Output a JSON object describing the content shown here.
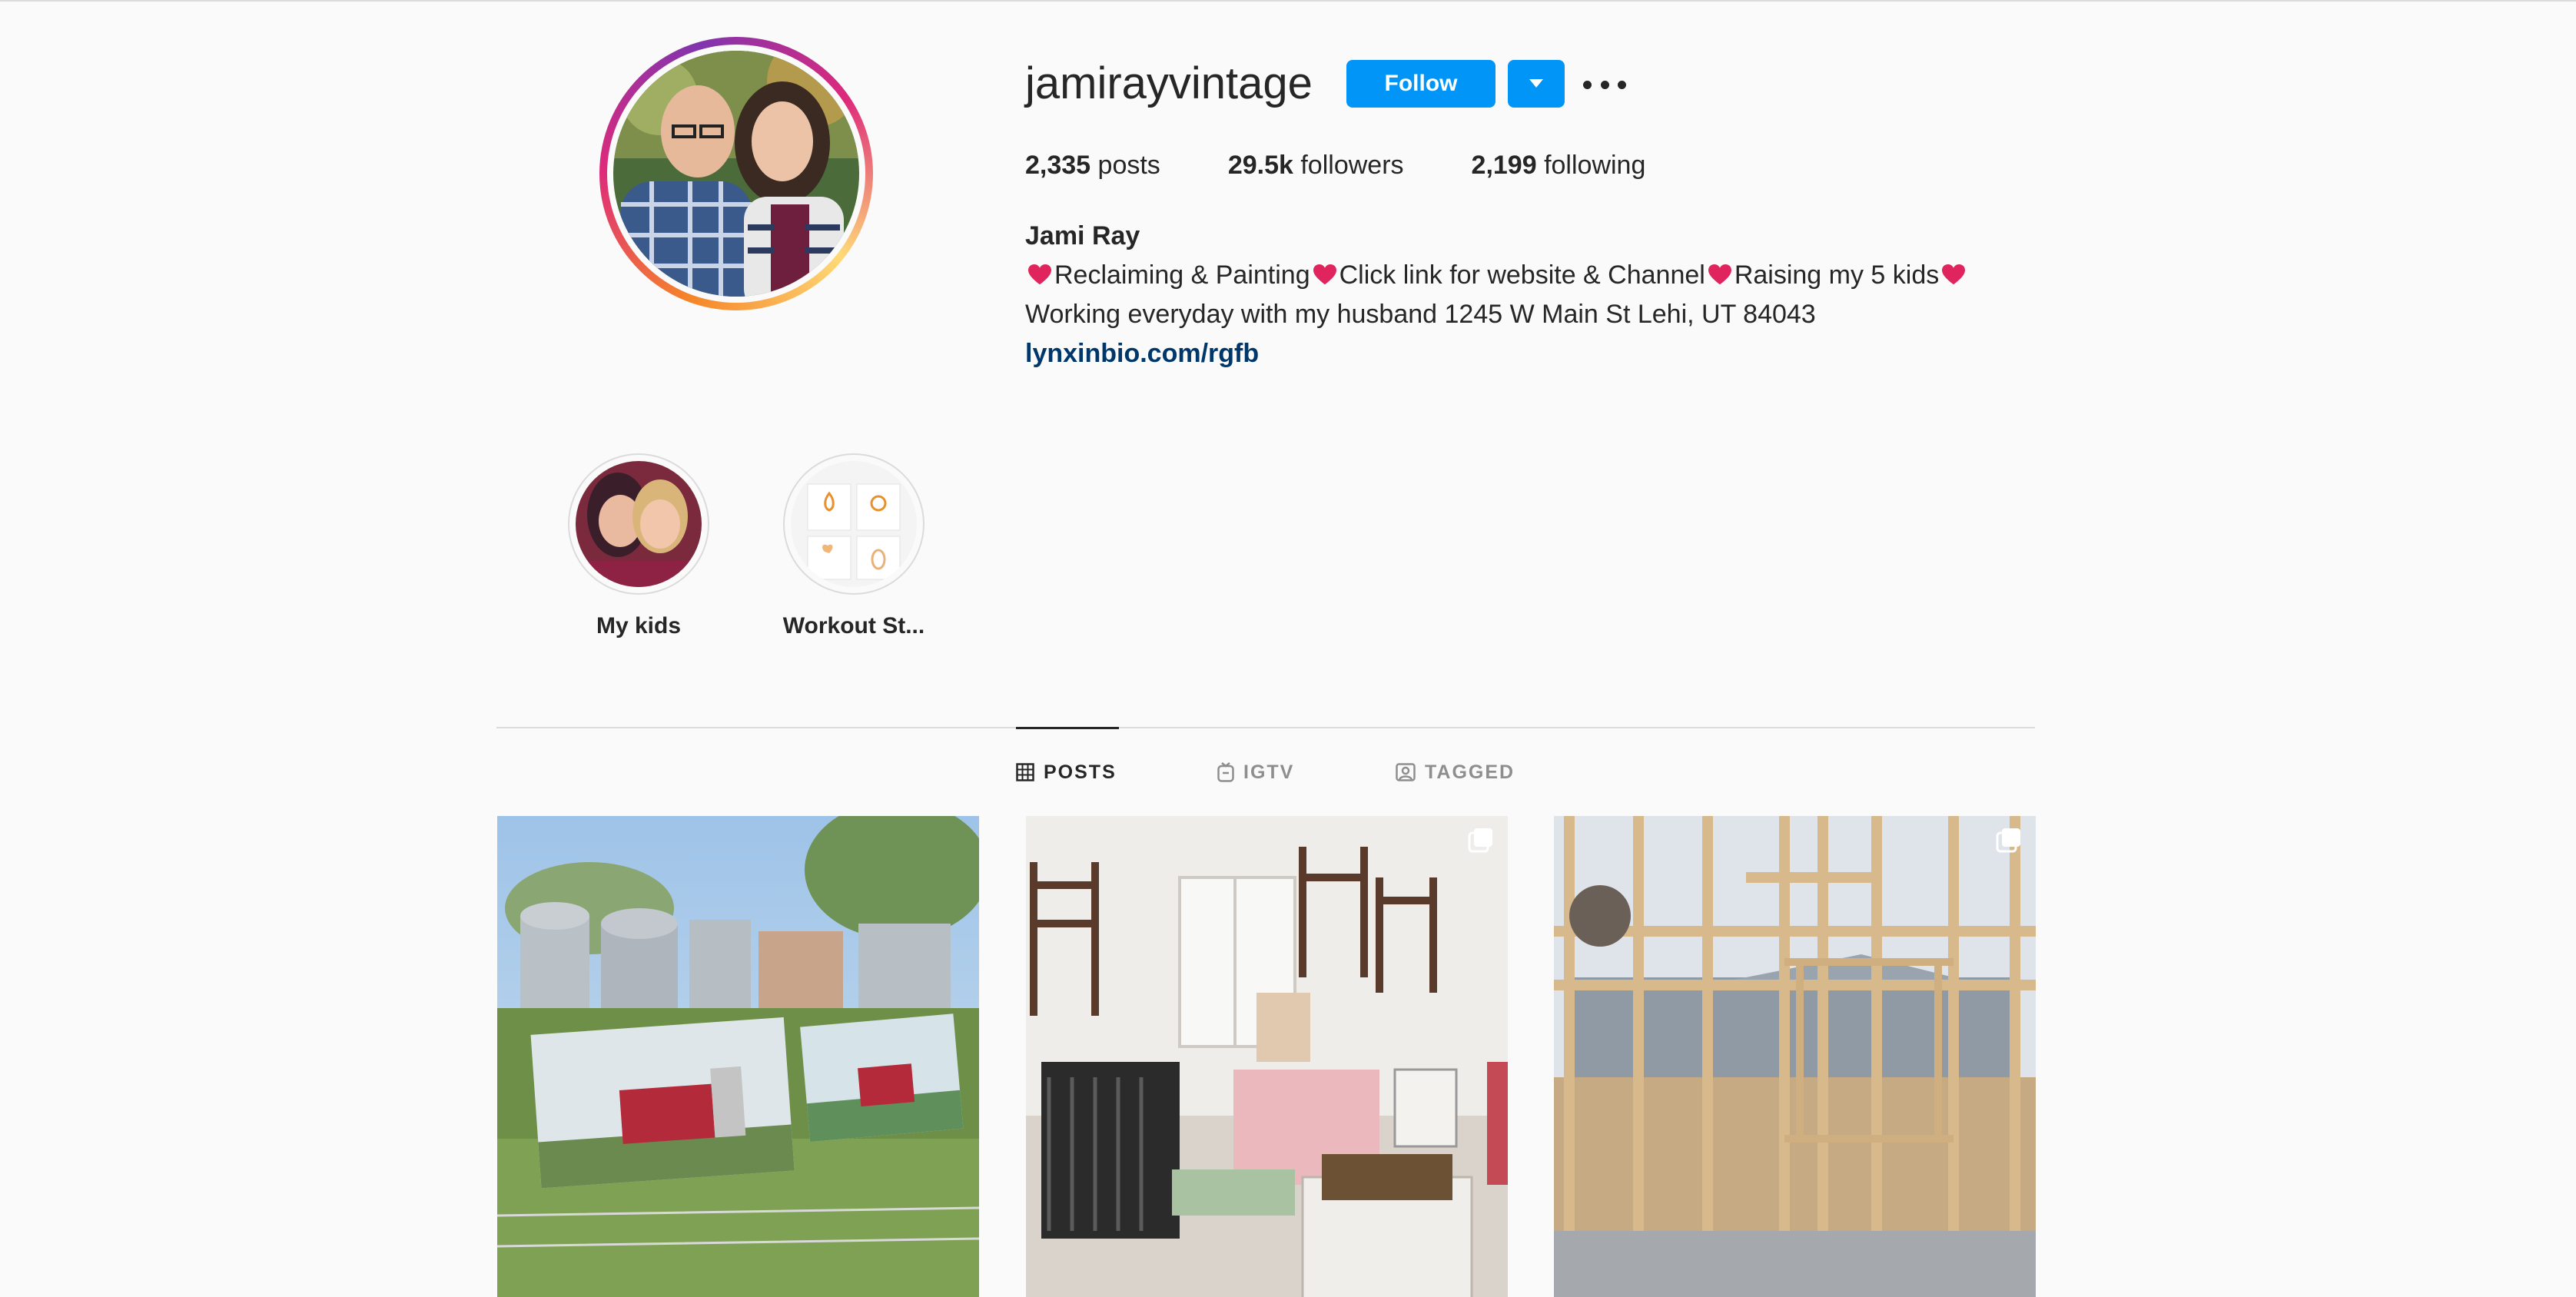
{
  "profile": {
    "username": "jamirayvintage",
    "follow_label": "Follow",
    "stats": [
      {
        "count": "2,335",
        "label": "posts"
      },
      {
        "count": "29.5k",
        "label": "followers"
      },
      {
        "count": "2,199",
        "label": "following"
      }
    ],
    "name": "Jami Ray",
    "bio_line1_a": "Reclaiming & Painting",
    "bio_line1_b": "Click link for website & Channel",
    "bio_line1_c": "Raising my 5 kids",
    "bio_line2": "Working everyday with my husband 1245 W Main St Lehi, UT 84043",
    "link": "lynxinbio.com/rgfb"
  },
  "highlights": [
    {
      "label": "My kids"
    },
    {
      "label": "Workout St..."
    }
  ],
  "tabs": [
    {
      "label": "POSTS",
      "icon": "grid-icon",
      "active": true
    },
    {
      "label": "IGTV",
      "icon": "igtv-icon",
      "active": false
    },
    {
      "label": "TAGGED",
      "icon": "tagged-icon",
      "active": false
    }
  ],
  "colors": {
    "follow_blue": "#0095f6",
    "link": "#00376b",
    "heart": "#e0245e"
  }
}
